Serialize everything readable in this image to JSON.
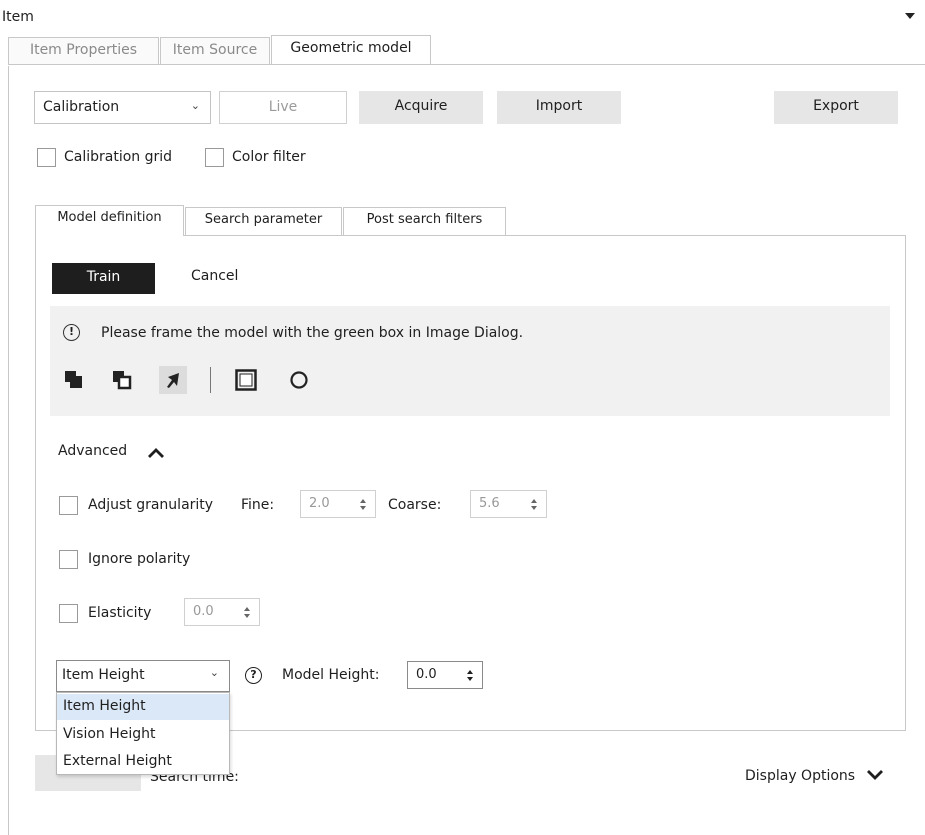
{
  "panel": {
    "title": "Item"
  },
  "tabs": [
    "Item Properties",
    "Item Source",
    "Geometric model"
  ],
  "toolbar": {
    "mode_select": {
      "value": "Calibration"
    },
    "live": "Live",
    "acquire": "Acquire",
    "import": "Import",
    "export": "Export"
  },
  "checkboxes": {
    "calibration_grid": "Calibration grid",
    "color_filter": "Color filter"
  },
  "subtabs": [
    "Model definition",
    "Search parameter",
    "Post search filters"
  ],
  "actions": {
    "train": "Train",
    "cancel": "Cancel"
  },
  "info": {
    "message": "Please frame the model with the green box in Image Dialog."
  },
  "advanced": {
    "label": "Advanced",
    "adjust_granularity": "Adjust granularity",
    "fine_label": "Fine:",
    "fine_value": "2.0",
    "coarse_label": "Coarse:",
    "coarse_value": "5.6",
    "ignore_polarity": "Ignore polarity",
    "elasticity": "Elasticity",
    "elasticity_value": "0.0"
  },
  "height": {
    "select_value": "Item Height",
    "options": [
      "Item Height",
      "Vision Height",
      "External Height"
    ],
    "model_height_label": "Model Height:",
    "model_height_value": "0.0"
  },
  "footer": {
    "search_time": "Search time:",
    "display_options": "Display Options"
  }
}
